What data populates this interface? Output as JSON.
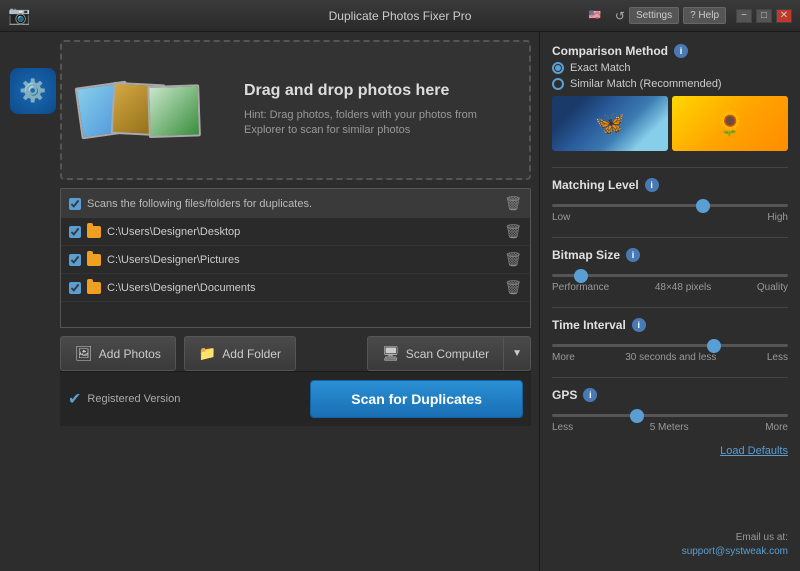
{
  "titlebar": {
    "title": "Duplicate Photos Fixer Pro",
    "settings_label": "Settings",
    "help_label": "? Help",
    "minimize_label": "−",
    "maximize_label": "□",
    "close_label": "✕"
  },
  "dropzone": {
    "title": "Drag and drop photos here",
    "hint": "Hint: Drag photos, folders with your photos from Explorer to scan for similar photos"
  },
  "filelist": {
    "header": "Scans the following files/folders for duplicates.",
    "items": [
      {
        "path": "C:\\Users\\Designer\\Desktop"
      },
      {
        "path": "C:\\Users\\Designer\\Pictures"
      },
      {
        "path": "C:\\Users\\Designer\\Documents"
      }
    ]
  },
  "buttons": {
    "add_photos": "Add Photos",
    "add_folder": "Add Folder",
    "scan_computer": "Scan Computer",
    "scan_duplicates": "Scan for Duplicates"
  },
  "status": {
    "registered": "Registered Version"
  },
  "settings": {
    "comparison_method_title": "Comparison Method",
    "exact_match": "Exact Match",
    "similar_match": "Similar Match (Recommended)",
    "matching_level_title": "Matching Level",
    "matching_level_low": "Low",
    "matching_level_high": "High",
    "bitmap_size_title": "Bitmap Size",
    "bitmap_size_perf": "Performance",
    "bitmap_size_val": "48×48 pixels",
    "bitmap_size_quality": "Quality",
    "time_interval_title": "Time Interval",
    "time_interval_more": "More",
    "time_interval_val": "30 seconds and less",
    "time_interval_less": "Less",
    "gps_title": "GPS",
    "gps_less": "Less",
    "gps_val": "5 Meters",
    "gps_more": "More",
    "load_defaults": "Load Defaults"
  },
  "email": {
    "label": "Email us at:",
    "address": "support@systweak.com"
  },
  "sliders": {
    "matching_level_pct": 65,
    "bitmap_size_pct": 10,
    "time_interval_pct": 70,
    "gps_pct": 35
  }
}
